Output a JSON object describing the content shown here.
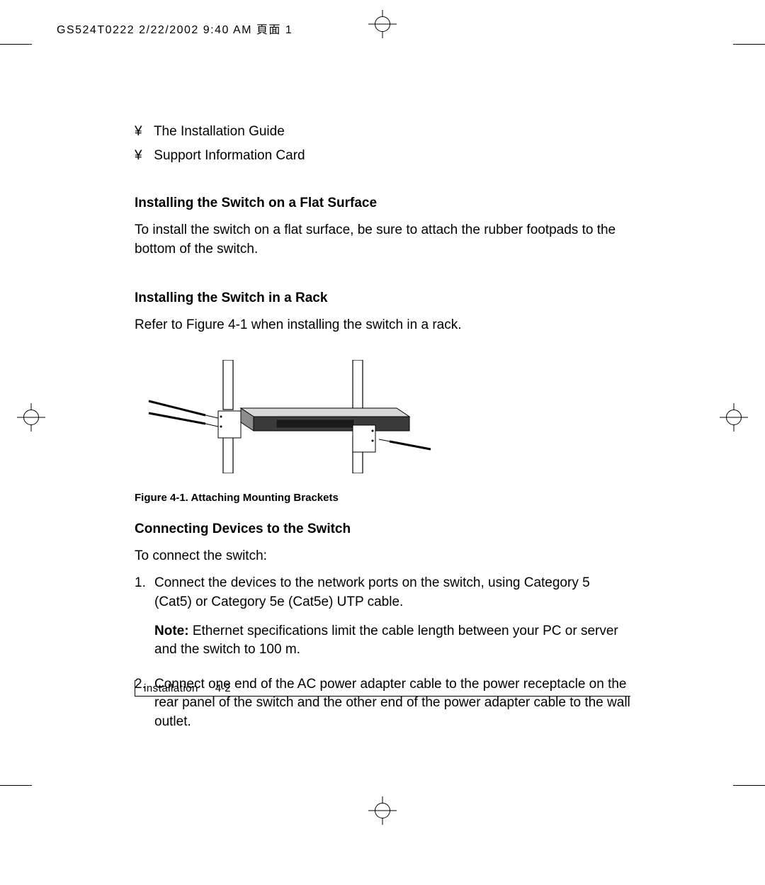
{
  "header": "GS524T0222 2/22/2002 9:40 AM 頁面 1",
  "bullets": [
    "The Installation Guide",
    "Support Information Card"
  ],
  "bullet_glyph": "¥",
  "sections": {
    "flat": {
      "title": "Installing the Switch on a Flat Surface",
      "body": "To install the switch on a flat surface, be sure to attach the rubber footpads to the bottom of the switch."
    },
    "rack": {
      "title": "Installing the Switch in a Rack",
      "body": "Refer to Figure 4-1 when installing the switch in a rack."
    },
    "connect": {
      "title": "Connecting Devices to the Switch",
      "intro": "To connect the switch:",
      "steps": [
        {
          "num": "1.",
          "text": "Connect the devices to the network ports on the switch, using Category 5 (Cat5) or Category 5e (Cat5e) UTP cable.",
          "note_label": "Note:",
          "note": "Ethernet specifications limit the cable length between your PC or server and the switch to 100 m."
        },
        {
          "num": "2.",
          "text": "Connect one end of the AC power adapter cable to the power receptacle on the rear panel of the switch and the other end of the power adapter cable to the wall outlet."
        }
      ]
    }
  },
  "figure_caption": "Figure 4-1.  Attaching Mounting Brackets",
  "footer": {
    "section": "installation",
    "page": "4-2"
  }
}
